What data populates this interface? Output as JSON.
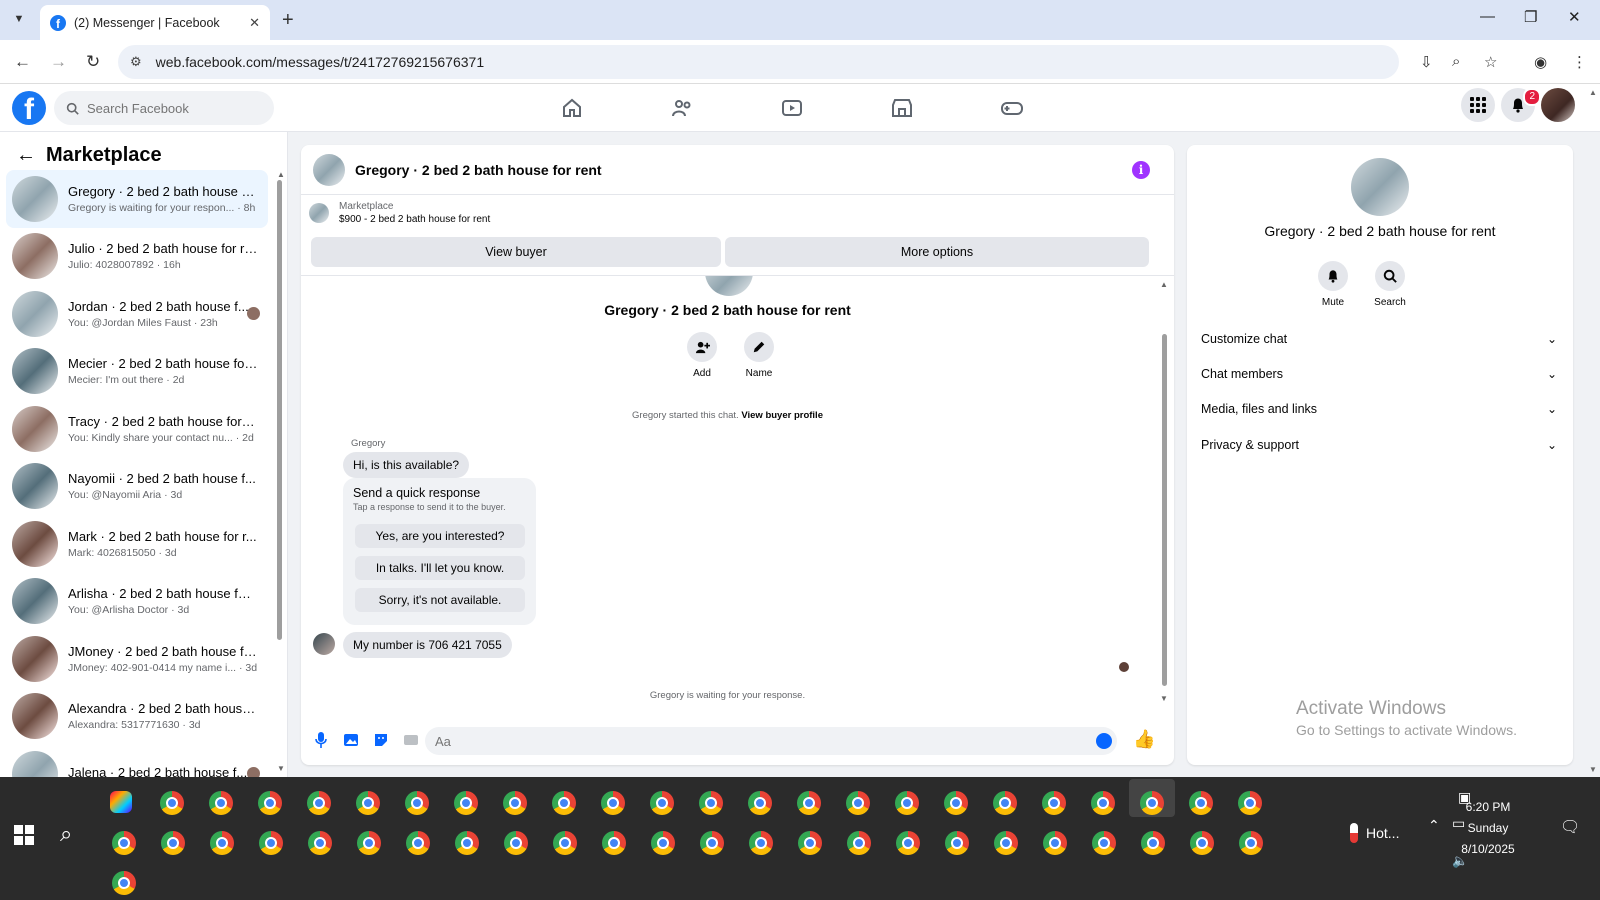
{
  "browser": {
    "tab_title": "(2) Messenger | Facebook",
    "url": "web.facebook.com/messages/t/24172769215676371"
  },
  "header": {
    "search_placeholder": "Search Facebook",
    "notification_count": "2"
  },
  "left": {
    "title": "Marketplace",
    "conversations": [
      {
        "name": "Gregory · 2 bed 2 bath house fo...",
        "snippet": "Gregory is waiting for your respon... · 8h"
      },
      {
        "name": "Julio · 2 bed 2 bath house for re...",
        "snippet": "Julio: 4028007892 · 16h"
      },
      {
        "name": "Jordan · 2 bed 2 bath house f...",
        "snippet": "You: @Jordan Miles Faust · 23h"
      },
      {
        "name": "Mecier · 2 bed 2 bath house for ...",
        "snippet": "Mecier: I'm out there · 2d"
      },
      {
        "name": "Tracy · 2 bed 2 bath house for r...",
        "snippet": "You: Kindly share your contact nu... · 2d"
      },
      {
        "name": "Nayomii · 2 bed 2 bath house f...",
        "snippet": "You: @Nayomii Aria · 3d"
      },
      {
        "name": "Mark · 2 bed 2 bath house for r...",
        "snippet": "Mark: 4026815050 · 3d"
      },
      {
        "name": "Arlisha · 2 bed 2 bath house for...",
        "snippet": "You: @Arlisha Doctor · 3d"
      },
      {
        "name": "JMoney · 2 bed 2 bath house fo...",
        "snippet": "JMoney: 402-901-0414 my name i... · 3d"
      },
      {
        "name": "Alexandra · 2 bed 2 bath house ...",
        "snippet": "Alexandra: 5317771630 · 3d"
      },
      {
        "name": "Jalena · 2 bed 2 bath house f...",
        "snippet": ""
      }
    ]
  },
  "chat": {
    "title": "Gregory · 2 bed 2 bath house for rent",
    "marketplace_label": "Marketplace",
    "listing": "$900 - 2 bed 2 bath house for rent",
    "view_buyer": "View buyer",
    "more_options": "More options",
    "body_title": "Gregory · 2 bed 2 bath house for rent",
    "add_label": "Add",
    "name_label": "Name",
    "started_text": "Gregory started this chat.",
    "view_buyer_profile": "View buyer profile",
    "sender": "Gregory",
    "msg1": "Hi, is this available?",
    "quick_title": "Send a quick response",
    "quick_sub": "Tap a response to send it to the buyer.",
    "quick_responses": [
      "Yes, are you interested?",
      "In talks. I'll let you know.",
      "Sorry, it's not available."
    ],
    "msg2": "My number is 706 421 7055",
    "waiting": "Gregory is waiting for your response.",
    "composer_placeholder": "Aa"
  },
  "right": {
    "name": "Gregory · 2 bed 2 bath house for rent",
    "mute": "Mute",
    "search": "Search",
    "sections": [
      "Customize chat",
      "Chat members",
      "Media, files and links",
      "Privacy & support"
    ]
  },
  "watermark": {
    "line1": "Activate Windows",
    "line2": "Go to Settings to activate Windows."
  },
  "taskbar": {
    "weather": "Hot...",
    "time": "6:20 PM",
    "day": "Sunday",
    "date": "8/10/2025"
  }
}
